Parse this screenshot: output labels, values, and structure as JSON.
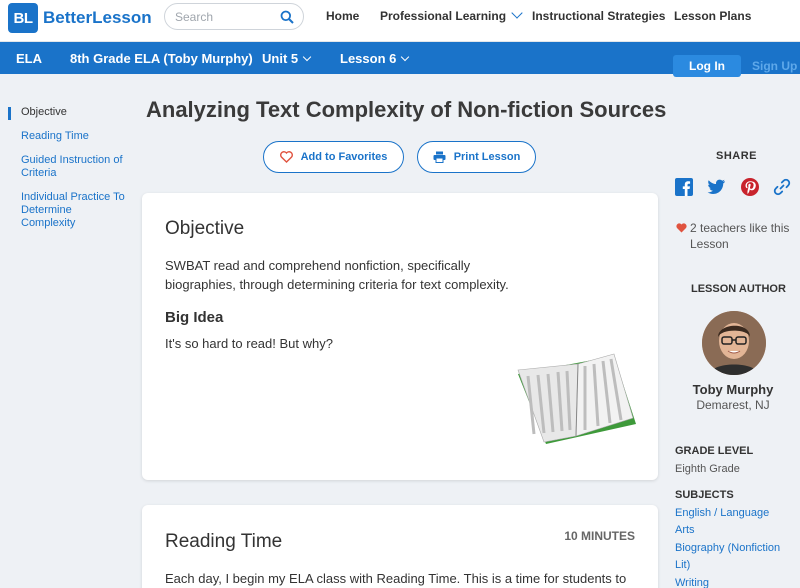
{
  "brand": {
    "badge": "BL",
    "name": "BetterLesson"
  },
  "search": {
    "placeholder": "Search"
  },
  "topnav": {
    "home": "Home",
    "professional_learning": "Professional Learning",
    "instructional_strategies": "Instructional Strategies",
    "lesson_plans": "Lesson Plans"
  },
  "subnav": {
    "subject": "ELA",
    "course": "8th Grade ELA (Toby Murphy)",
    "unit": "Unit 5",
    "lesson": "Lesson 6",
    "login": "Log In",
    "signup": "Sign Up"
  },
  "sidebar": {
    "items": [
      {
        "label": "Objective"
      },
      {
        "label": "Reading Time"
      },
      {
        "label": "Guided Instruction of Criteria"
      },
      {
        "label": "Individual Practice To Determine Complexity"
      }
    ]
  },
  "lesson": {
    "title": "Analyzing Text Complexity of Non-fiction Sources",
    "add_favorites": "Add to Favorites",
    "print_lesson": "Print Lesson"
  },
  "objective_card": {
    "heading": "Objective",
    "text_line1": "SWBAT read and comprehend nonfiction, specifically",
    "text_line2": "biographies, through determining criteria for text complexity.",
    "big_idea_heading": "Big Idea",
    "big_idea_text": "It's so hard to read! But why?"
  },
  "reading_card": {
    "heading": "Reading Time",
    "duration": "10 MINUTES",
    "text": "Each day, I begin my ELA class with Reading Time.  This is a time for students to"
  },
  "right_panel": {
    "share_label": "SHARE",
    "likes_line1": "2 teachers like this",
    "likes_line2": "Lesson",
    "author_label": "LESSON AUTHOR",
    "author_name": "Toby Murphy",
    "author_location": "Demarest, NJ",
    "grade_label": "GRADE LEVEL",
    "grade_value": "Eighth Grade",
    "subjects_label": "SUBJECTS",
    "subjects": [
      "English / Language Arts",
      "Biography (Nonfiction Lit)",
      "Writing"
    ]
  },
  "colors": {
    "brand_blue": "#1a73c9",
    "heart_red": "#e0533f"
  }
}
